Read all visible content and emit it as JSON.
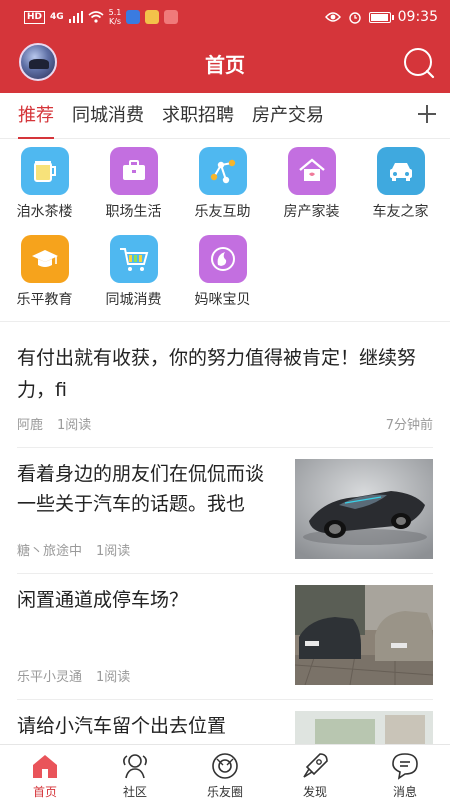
{
  "status_bar": {
    "hd": "HD",
    "signal": "4G",
    "net_speed_value": "5.1",
    "net_speed_unit": "K/s",
    "time": "09:35"
  },
  "header": {
    "title": "首页"
  },
  "tabs": [
    {
      "label": "推荐",
      "active": true
    },
    {
      "label": "同城消费",
      "active": false
    },
    {
      "label": "求职招聘",
      "active": false
    },
    {
      "label": "房产交易",
      "active": false
    }
  ],
  "categories": [
    {
      "label": "洎水茶楼",
      "icon": "tea-cup-icon",
      "color": "#4fb8f0"
    },
    {
      "label": "职场生活",
      "icon": "briefcase-icon",
      "color": "#c36fe0"
    },
    {
      "label": "乐友互助",
      "icon": "share-network-icon",
      "color": "#4fb8f0"
    },
    {
      "label": "房产家装",
      "icon": "house-icon",
      "color": "#c36fe0"
    },
    {
      "label": "车友之家",
      "icon": "car-icon",
      "color": "#3fa9df"
    },
    {
      "label": "乐平教育",
      "icon": "graduation-cap-icon",
      "color": "#f6a31c"
    },
    {
      "label": "同城消费",
      "icon": "shopping-cart-icon",
      "color": "#4fb8f0"
    },
    {
      "label": "妈咪宝贝",
      "icon": "baby-icon",
      "color": "#c36fe0"
    }
  ],
  "posts": [
    {
      "title": "有付出就有收获，你的努力值得被肯定！继续努力，fi",
      "author": "阿鹿",
      "reads": "1阅读",
      "time": "7分钟前"
    },
    {
      "title": "看着身边的朋友们在侃侃而谈一些关于汽车的话题。我也",
      "author": "糖丶旅途中",
      "reads": "1阅读",
      "image": "sports-car-photo"
    },
    {
      "title": "闲置通道成停车场？",
      "author": "乐平小灵通",
      "reads": "1阅读",
      "image": "parking-lot-photo"
    },
    {
      "title": "请给小汽车留个出去位置",
      "author": "",
      "reads": "",
      "image": "street-photo"
    }
  ],
  "bottom_nav": [
    {
      "label": "首页",
      "icon": "home-icon",
      "active": true
    },
    {
      "label": "社区",
      "icon": "community-icon",
      "active": false
    },
    {
      "label": "乐友圈",
      "icon": "friends-circle-icon",
      "active": false
    },
    {
      "label": "发现",
      "icon": "rocket-icon",
      "active": false
    },
    {
      "label": "消息",
      "icon": "message-icon",
      "active": false
    }
  ],
  "colors": {
    "brand": "#d5353a",
    "meta_text": "#9a9a9a"
  }
}
